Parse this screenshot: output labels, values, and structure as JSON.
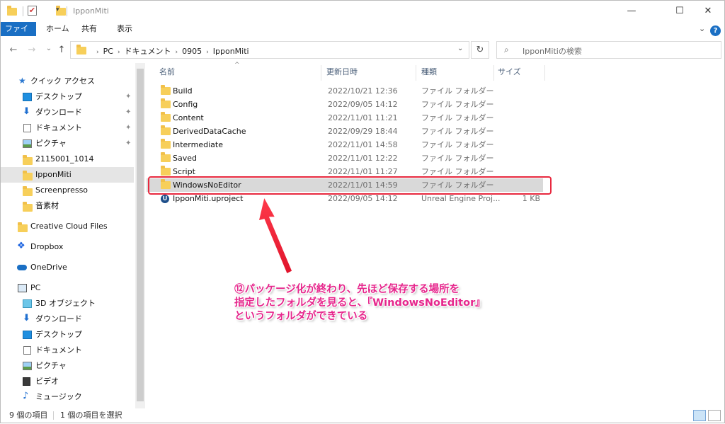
{
  "window": {
    "title": "IpponMiti",
    "minimize": "—",
    "maximize": "☐",
    "close": "✕"
  },
  "ribbon": {
    "tabs": [
      "ファイル",
      "ホーム",
      "共有",
      "表示"
    ],
    "expand": "⌄",
    "help": "?"
  },
  "nav": {
    "back": "←",
    "forward": "→",
    "recent": "⌄",
    "up": "↑",
    "breadcrumbs": [
      "PC",
      "ドキュメント",
      "0905",
      "IpponMiti"
    ],
    "refresh": "↻",
    "search_placeholder": "IpponMitiの検索"
  },
  "sidebar": {
    "items": [
      {
        "label": "クイック アクセス",
        "icon": "star-icon",
        "pinned": false
      },
      {
        "label": "デスクトップ",
        "icon": "desktop-icon",
        "pinned": true
      },
      {
        "label": "ダウンロード",
        "icon": "download-icon",
        "pinned": true
      },
      {
        "label": "ドキュメント",
        "icon": "document-icon",
        "pinned": true
      },
      {
        "label": "ピクチャ",
        "icon": "pictures-icon",
        "pinned": true
      },
      {
        "label": "2115001_1014",
        "icon": "folder-icon",
        "pinned": false
      },
      {
        "label": "IpponMiti",
        "icon": "folder-icon",
        "pinned": false,
        "selected": true
      },
      {
        "label": "Screenpresso",
        "icon": "folder-icon",
        "pinned": false
      },
      {
        "label": "音素材",
        "icon": "folder-icon",
        "pinned": false
      },
      {
        "label": "Creative Cloud Files",
        "icon": "creative-cloud-icon",
        "pinned": false
      },
      {
        "label": "Dropbox",
        "icon": "dropbox-icon",
        "pinned": false
      },
      {
        "label": "OneDrive",
        "icon": "onedrive-icon",
        "pinned": false
      },
      {
        "label": "PC",
        "icon": "pc-icon",
        "pinned": false
      },
      {
        "label": "3D オブジェクト",
        "icon": "3d-objects-icon",
        "pinned": false
      },
      {
        "label": "ダウンロード",
        "icon": "download-icon",
        "pinned": false
      },
      {
        "label": "デスクトップ",
        "icon": "desktop-icon",
        "pinned": false
      },
      {
        "label": "ドキュメント",
        "icon": "document-icon",
        "pinned": false
      },
      {
        "label": "ピクチャ",
        "icon": "pictures-icon",
        "pinned": false
      },
      {
        "label": "ビデオ",
        "icon": "video-icon",
        "pinned": false
      },
      {
        "label": "ミュージック",
        "icon": "music-icon",
        "pinned": false
      }
    ],
    "pin_glyph": "📌"
  },
  "columns": {
    "name": "名前",
    "date": "更新日時",
    "type": "種類",
    "size": "サイズ"
  },
  "files": [
    {
      "name": "Build",
      "date": "2022/10/21 12:36",
      "type": "ファイル フォルダー",
      "size": "",
      "kind": "folder"
    },
    {
      "name": "Config",
      "date": "2022/09/05 14:12",
      "type": "ファイル フォルダー",
      "size": "",
      "kind": "folder"
    },
    {
      "name": "Content",
      "date": "2022/11/01 11:21",
      "type": "ファイル フォルダー",
      "size": "",
      "kind": "folder"
    },
    {
      "name": "DerivedDataCache",
      "date": "2022/09/29 18:44",
      "type": "ファイル フォルダー",
      "size": "",
      "kind": "folder"
    },
    {
      "name": "Intermediate",
      "date": "2022/11/01 14:58",
      "type": "ファイル フォルダー",
      "size": "",
      "kind": "folder"
    },
    {
      "name": "Saved",
      "date": "2022/11/01 12:22",
      "type": "ファイル フォルダー",
      "size": "",
      "kind": "folder"
    },
    {
      "name": "Script",
      "date": "2022/11/01 11:27",
      "type": "ファイル フォルダー",
      "size": "",
      "kind": "folder"
    },
    {
      "name": "WindowsNoEditor",
      "date": "2022/11/01 14:59",
      "type": "ファイル フォルダー",
      "size": "",
      "kind": "folder",
      "selected": true
    },
    {
      "name": "IpponMiti.uproject",
      "date": "2022/09/05 14:12",
      "type": "Unreal Engine Proj...",
      "size": "1 KB",
      "kind": "uproject"
    }
  ],
  "annotation": {
    "lines": [
      "⑫パッケージ化が終わり、先ほど保存する場所を",
      "指定したフォルダを見ると、『WindowsNoEditor』",
      "というフォルダができている"
    ],
    "color": "#e6268c",
    "box_color": "#e8293f"
  },
  "status": {
    "count": "9 個の項目",
    "selected": "1 個の項目を選択"
  }
}
